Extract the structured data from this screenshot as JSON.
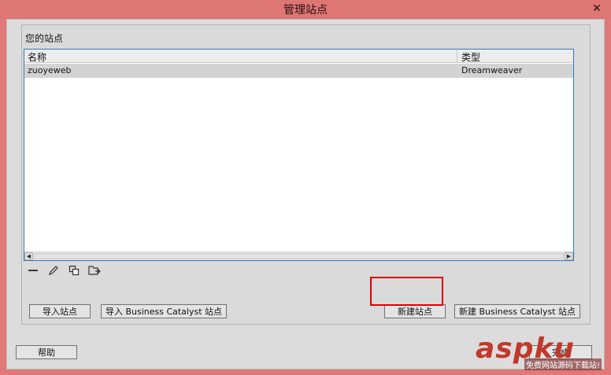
{
  "window": {
    "title": "管理站点",
    "close_label": "✕"
  },
  "group": {
    "title": "您的站点"
  },
  "list": {
    "columns": [
      "名称",
      "类型"
    ],
    "rows": [
      {
        "name": "zuoyeweb",
        "type": "Dreamweaver"
      }
    ]
  },
  "toolbar": {
    "icons": [
      "remove-icon",
      "edit-icon",
      "duplicate-icon",
      "export-icon"
    ]
  },
  "buttons": {
    "import_site": "导入站点",
    "import_bc": "导入 Business Catalyst 站点",
    "new_site": "新建站点",
    "new_bc": "新建 Business Catalyst 站点",
    "help": "帮助",
    "done": "完成"
  },
  "watermark": {
    "logo": "aspku",
    "tagline": "免费网站源码下载站!"
  },
  "colors": {
    "titlebar": "#de7674",
    "selection_highlight": "#e00000",
    "row_selected": "#d3d3d3"
  }
}
